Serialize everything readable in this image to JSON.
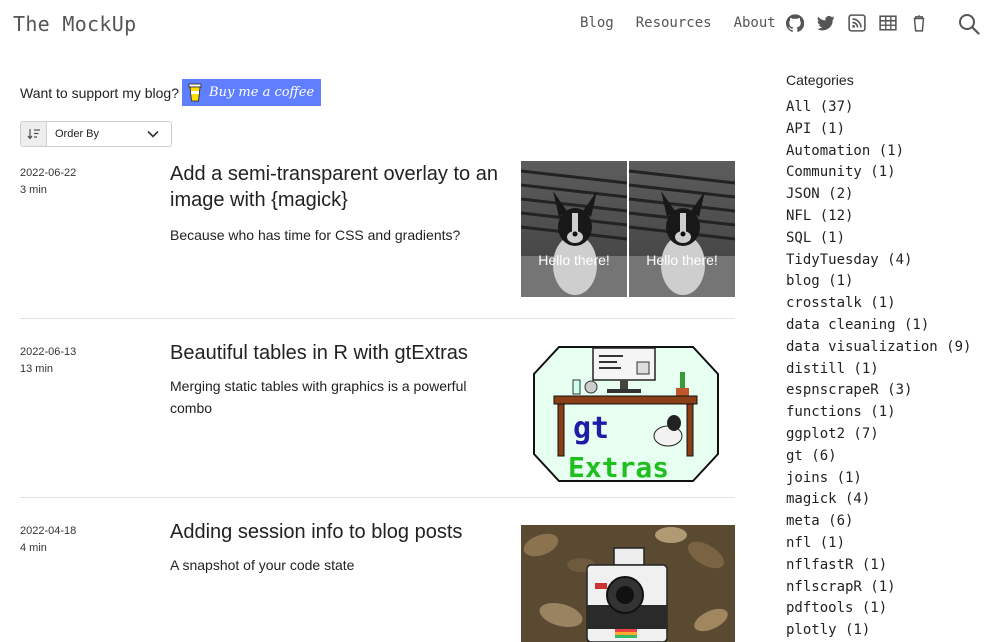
{
  "brand": "The MockUp",
  "nav": {
    "links": [
      "Blog",
      "Resources",
      "About"
    ],
    "icons": [
      "github-icon",
      "twitter-icon",
      "rss-icon",
      "table-icon",
      "cup-icon"
    ],
    "search_icon": "search-icon"
  },
  "support": {
    "text": "Want to support my blog?",
    "button_label": "Buy me a coffee",
    "button_color": "#5f7fff"
  },
  "sort": {
    "label": "Order By"
  },
  "posts": [
    {
      "date": "2022-06-22",
      "read_time": "3 min",
      "title": "Add a semi-transparent overlay to an image with {magick}",
      "description": "Because who has time for CSS and gradients?",
      "thumb_texts": [
        "Hello there!",
        "Hello there!"
      ]
    },
    {
      "date": "2022-06-13",
      "read_time": "13 min",
      "title": "Beautiful tables in R with gtExtras",
      "description": "Merging static tables with graphics is a powerful combo",
      "thumb_texts": [
        "gt",
        "Extras"
      ]
    },
    {
      "date": "2022-04-18",
      "read_time": "4 min",
      "title": "Adding session info to blog posts",
      "description": "A snapshot of your code state",
      "thumb_texts": []
    }
  ],
  "categories": {
    "title": "Categories",
    "items": [
      "All (37)",
      "API (1)",
      "Automation (1)",
      "Community (1)",
      "JSON (2)",
      "NFL (12)",
      "SQL (1)",
      "TidyTuesday (4)",
      "blog (1)",
      "crosstalk (1)",
      "data cleaning (1)",
      "data visualization (9)",
      "distill (1)",
      "espnscrapeR (3)",
      "functions (1)",
      "ggplot2 (7)",
      "gt (6)",
      "joins (1)",
      "magick (4)",
      "meta (6)",
      "nfl (1)",
      "nflfastR (1)",
      "nflscrapR (1)",
      "pdftools (1)",
      "plotly (1)"
    ]
  }
}
